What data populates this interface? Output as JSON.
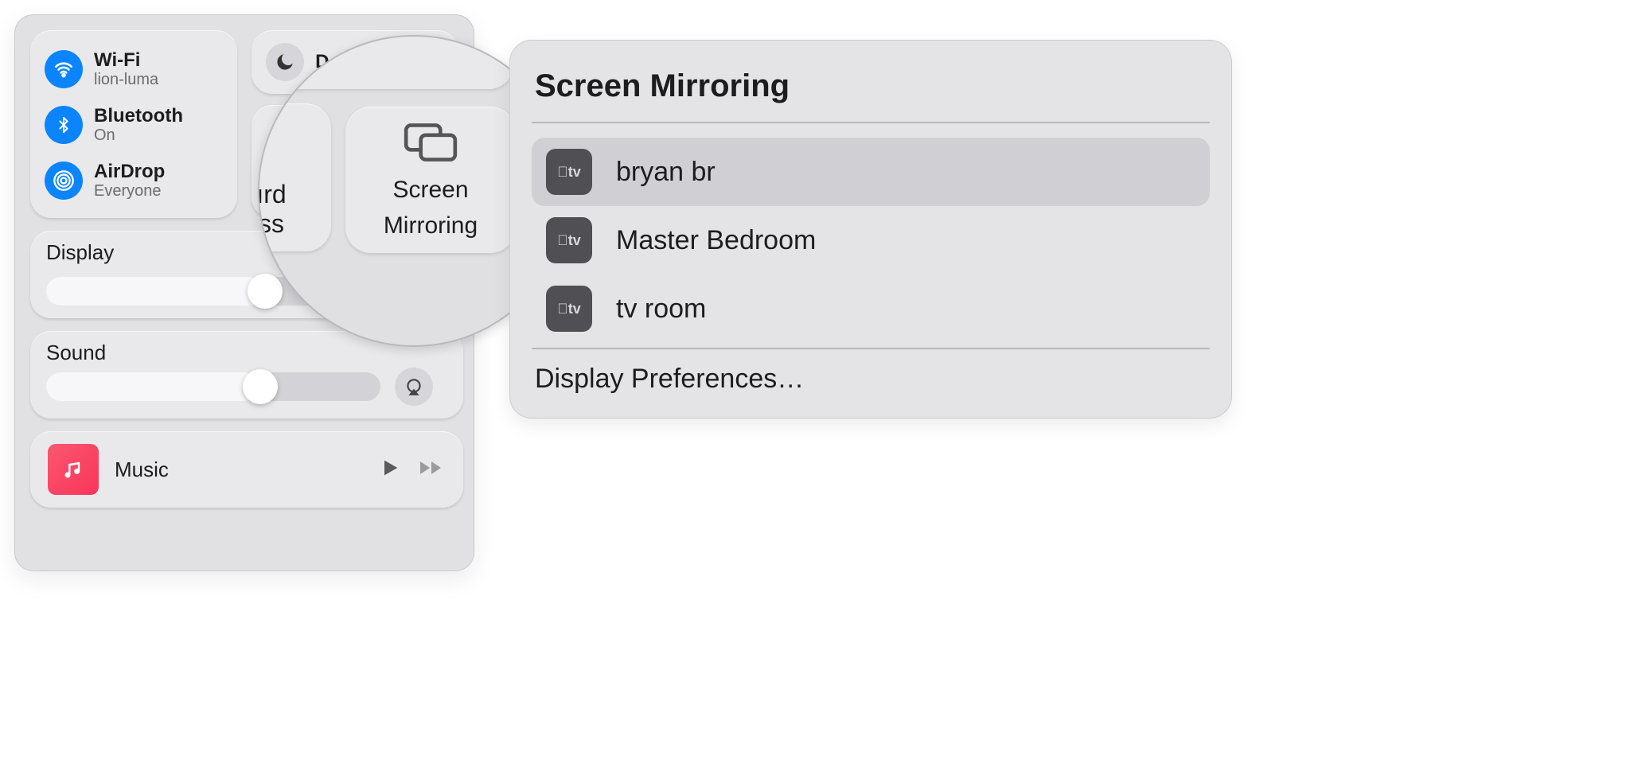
{
  "control_center": {
    "wifi": {
      "label": "Wi-Fi",
      "status": "lion-luma"
    },
    "bluetooth": {
      "label": "Bluetooth",
      "status": "On"
    },
    "airdrop": {
      "label": "AirDrop",
      "status": "Everyone"
    },
    "dnd": {
      "label": "Do Not Disturb",
      "label_visible": "D"
    },
    "keyboard_brightness": {
      "label": "Keyboard Brightness",
      "label_visible_line1": "ard",
      "label_visible_line2": "ess"
    },
    "screen_mirroring_tile": {
      "label": "Screen Mirroring"
    },
    "display_section": {
      "label": "Display",
      "slider_value_pct": 55
    },
    "sound_section": {
      "label": "Sound",
      "slider_value_pct": 64
    },
    "now_playing": {
      "app": "Music"
    }
  },
  "magnifier": {
    "screen_mirroring_label_line1": "Screen",
    "screen_mirroring_label_line2": "Mirroring",
    "kb_visible_line1": "ırd",
    "kb_visible_line2": "ss"
  },
  "mirroring_panel": {
    "title": "Screen Mirroring",
    "item0": {
      "name": "bryan br",
      "type_badge": "tv",
      "selected": true
    },
    "item1": {
      "name": "Master Bedroom",
      "type_badge": "tv",
      "selected": false
    },
    "item2": {
      "name": "tv room",
      "type_badge": "tv",
      "selected": false
    },
    "footer": "Display Preferences…"
  }
}
